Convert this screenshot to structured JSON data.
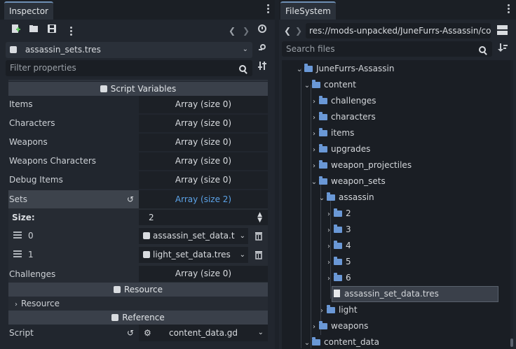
{
  "inspector": {
    "tab_label": "Inspector",
    "resource_name": "assassin_sets.tres",
    "filter_placeholder": "Filter properties",
    "script_variables_header": "Script Variables",
    "properties": [
      {
        "label": "Items",
        "value": "Array (size 0)"
      },
      {
        "label": "Characters",
        "value": "Array (size 0)"
      },
      {
        "label": "Weapons",
        "value": "Array (size 0)"
      },
      {
        "label": "Weapons Characters",
        "value": "Array (size 0)"
      },
      {
        "label": "Debug Items",
        "value": "Array (size 0)"
      }
    ],
    "sets": {
      "label": "Sets",
      "value": "Array (size 2)",
      "size_label": "Size:",
      "size_value": "2",
      "elements": [
        {
          "index": "0",
          "value": "assassin_set_data.t"
        },
        {
          "index": "1",
          "value": "light_set_data.tres"
        }
      ]
    },
    "challenges": {
      "label": "Challenges",
      "value": "Array (size 0)"
    },
    "resource_header": "Resource",
    "resource_sub": "Resource",
    "reference_header": "Reference",
    "script": {
      "label": "Script",
      "value": "content_data.gd"
    }
  },
  "filesystem": {
    "tab_label": "FileSystem",
    "path": "res://mods-unpacked/JuneFurrs-Assassin/cont",
    "search_placeholder": "Search files",
    "tree": [
      {
        "label": "JuneFurrs-Assassin",
        "type": "folder",
        "expanded": true
      },
      {
        "label": "content",
        "type": "folder",
        "expanded": true
      },
      {
        "label": "challenges",
        "type": "folder",
        "expanded": false
      },
      {
        "label": "characters",
        "type": "folder",
        "expanded": false
      },
      {
        "label": "items",
        "type": "folder",
        "expanded": false
      },
      {
        "label": "upgrades",
        "type": "folder",
        "expanded": false
      },
      {
        "label": "weapon_projectiles",
        "type": "folder",
        "expanded": false
      },
      {
        "label": "weapon_sets",
        "type": "folder",
        "expanded": true
      },
      {
        "label": "assassin",
        "type": "folder",
        "expanded": true
      },
      {
        "label": "2",
        "type": "folder",
        "expanded": false
      },
      {
        "label": "3",
        "type": "folder",
        "expanded": false
      },
      {
        "label": "4",
        "type": "folder",
        "expanded": false
      },
      {
        "label": "5",
        "type": "folder",
        "expanded": false
      },
      {
        "label": "6",
        "type": "folder",
        "expanded": false
      },
      {
        "label": "assassin_set_data.tres",
        "type": "file",
        "selected": true
      },
      {
        "label": "light",
        "type": "folder",
        "expanded": false
      },
      {
        "label": "weapons",
        "type": "folder",
        "expanded": false
      },
      {
        "label": "content_data",
        "type": "folder",
        "expanded": true
      }
    ]
  },
  "colors": {
    "accent": "#6e8fb5",
    "link": "#5ca3e8",
    "folder": "#6a98d6"
  }
}
